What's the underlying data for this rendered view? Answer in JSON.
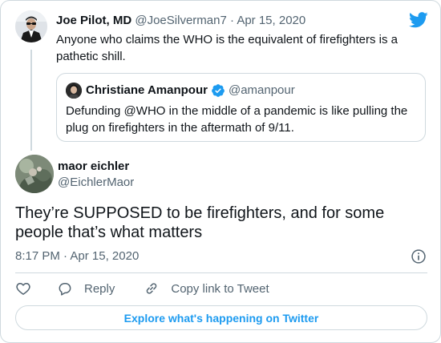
{
  "parent_tweet": {
    "author_name": "Joe Pilot, MD",
    "author_handle": "@JoeSilverman7",
    "separator": "·",
    "date": "Apr 15, 2020",
    "text": "Anyone who claims the WHO is the equivalent of firefighters is a pathetic shill."
  },
  "quoted_tweet": {
    "author_name": "Christiane Amanpour",
    "author_handle": "@amanpour",
    "verified": true,
    "text": "Defunding @WHO in the middle of a pandemic is like pulling the plug on firefighters in the aftermath of 9/11."
  },
  "main_tweet": {
    "author_name": "maor eichler",
    "author_handle": "@EichlerMaor",
    "text": "They’re SUPPOSED to be firefighters, and for some people that’s what matters",
    "time": "8:17 PM",
    "separator": "·",
    "date": "Apr 15, 2020"
  },
  "actions": {
    "reply_label": "Reply",
    "copy_link_label": "Copy link to Tweet"
  },
  "explore_button_label": "Explore what's happening on Twitter",
  "icons": {
    "brand": "twitter-bird-icon",
    "like": "heart-icon",
    "reply": "speech-bubble-icon",
    "copy_link": "link-icon",
    "info": "info-icon",
    "verified": "verified-badge-icon"
  },
  "colors": {
    "brand_blue": "#1d9bf0",
    "text_primary": "#0f1419",
    "text_muted": "#536471",
    "border": "#cfd9de"
  }
}
